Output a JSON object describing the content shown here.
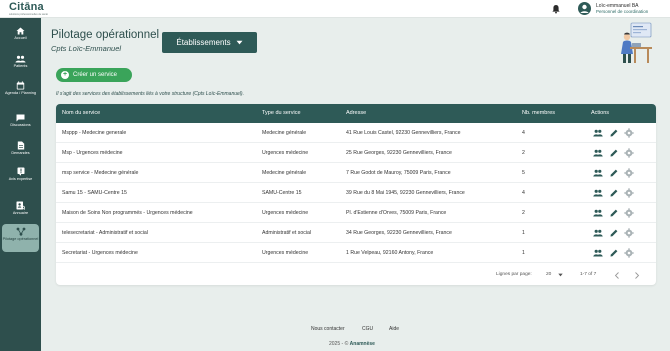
{
  "topbar": {
    "logo": "Citāna",
    "logo_sub": "solutions professionnelles de santé",
    "user_name": "Loïc-emmanuel BA",
    "user_role": "Personnel de coordination"
  },
  "sidebar": {
    "items": [
      {
        "label": "Accueil",
        "icon": "home-icon"
      },
      {
        "label": "Patients",
        "icon": "people-icon"
      },
      {
        "label": "Agenda / Planning",
        "icon": "calendar-icon"
      },
      {
        "label": "Discussions",
        "icon": "chat-icon"
      },
      {
        "label": "Demandes",
        "icon": "document-icon"
      },
      {
        "label": "Avis expertise",
        "icon": "expert-icon"
      },
      {
        "label": "Annuaire",
        "icon": "directory-icon"
      },
      {
        "label": "Pilotage opérationnel",
        "icon": "network-icon"
      }
    ]
  },
  "header": {
    "title": "Pilotage opérationnel",
    "subtitle": "Cpts Loïc-Emmanuel",
    "etablissements_label": "Établissements"
  },
  "create_button": "Créer un service",
  "info_text": "Il s'agit des services des établissements liés à votre structure (Cpts Loïc-Emmanuel).",
  "table": {
    "columns": [
      "Nom du service",
      "Type du service",
      "Adresse",
      "Nb. membres",
      "Actions"
    ],
    "rows": [
      {
        "name": "Msppp - Medecine generale",
        "type": "Medecine générale",
        "address": "41 Rue Louis Castel, 92230 Gennevilliers, France",
        "members": "4"
      },
      {
        "name": "Msp - Urgences médecine",
        "type": "Urgences médecine",
        "address": "25 Rue Georges, 92230 Gennevilliers, France",
        "members": "2"
      },
      {
        "name": "msp service - Medecine générale",
        "type": "Medecine générale",
        "address": "7 Rue Godot de Mauroy, 75009 Paris, France",
        "members": "5"
      },
      {
        "name": "Samu 15 - SAMU-Centre 15",
        "type": "SAMU-Centre 15",
        "address": "39 Rue du 8 Mai 1945, 92230 Gennevilliers, France",
        "members": "4"
      },
      {
        "name": "Maison de Soins Non programmés - Urgences médecine",
        "type": "Urgences médecine",
        "address": "Pl. d'Estienne d'Orves, 75009 Paris, France",
        "members": "2"
      },
      {
        "name": "telesecretariat - Administratif et social",
        "type": "Administratif et social",
        "address": "34 Rue Georges, 92230 Gennevilliers, France",
        "members": "1"
      },
      {
        "name": "Secretariat - Urgences médecine",
        "type": "Urgences médecine",
        "address": "1 Rue Velpeau, 92160 Antony, France",
        "members": "1"
      }
    ],
    "rows_per_page_label": "Lignes par page:",
    "rows_per_page_value": "20",
    "page_range": "1-7 of 7"
  },
  "footer": {
    "links": [
      "Nous contacter",
      "CGU",
      "Aide"
    ],
    "copyright": "2025 - ©",
    "brand": "Anamnèse"
  },
  "colors": {
    "primary": "#2e5a57",
    "sidebar": "#2e4f4d",
    "background": "#e8eeec",
    "success": "#3aa45a"
  }
}
